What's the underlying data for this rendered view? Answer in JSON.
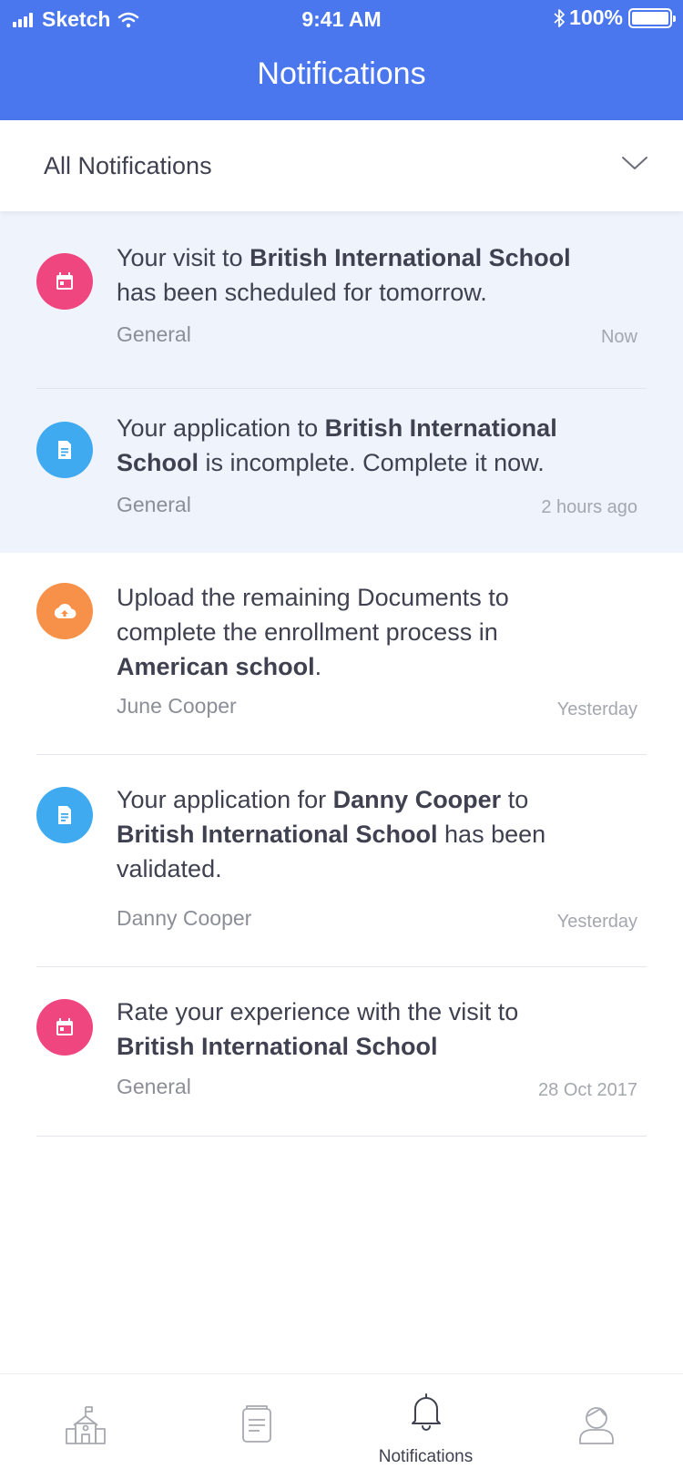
{
  "status_bar": {
    "carrier": "Sketch",
    "time": "9:41 AM",
    "battery": "100%"
  },
  "header": {
    "title": "Notifications"
  },
  "filter": {
    "selected": "All Notifications"
  },
  "notifications": [
    {
      "icon": "calendar-icon",
      "color": "#f0467f",
      "unread": true,
      "parts": [
        "Your visit to ",
        "British International School",
        " has been scheduled for tomorrow."
      ],
      "category": "General",
      "time": "Now"
    },
    {
      "icon": "document-icon",
      "color": "#3faaf0",
      "unread": true,
      "parts": [
        "Your application to ",
        "British International School",
        " is incomplete. Complete it now."
      ],
      "category": "General",
      "time": "2 hours ago"
    },
    {
      "icon": "cloud-upload-icon",
      "color": "#f7914a",
      "unread": false,
      "parts": [
        "Upload the remaining Documents to complete the enrollment process in ",
        "American school",
        "."
      ],
      "category": "June Cooper",
      "time": "Yesterday"
    },
    {
      "icon": "document-icon",
      "color": "#3faaf0",
      "unread": false,
      "parts": [
        "Your application for ",
        "Danny Cooper",
        " to ",
        "British International School",
        " has been validated."
      ],
      "category": "Danny Cooper",
      "time": "Yesterday"
    },
    {
      "icon": "calendar-icon",
      "color": "#f0467f",
      "unread": false,
      "parts": [
        "Rate your experience with the visit to ",
        "British International School"
      ],
      "category": "General",
      "time": "28 Oct 2017"
    }
  ],
  "tabbar": {
    "items": [
      {
        "icon": "school-icon",
        "label": ""
      },
      {
        "icon": "document-list-icon",
        "label": ""
      },
      {
        "icon": "bell-icon",
        "label": "Notifications",
        "active": true
      },
      {
        "icon": "profile-icon",
        "label": ""
      }
    ]
  }
}
